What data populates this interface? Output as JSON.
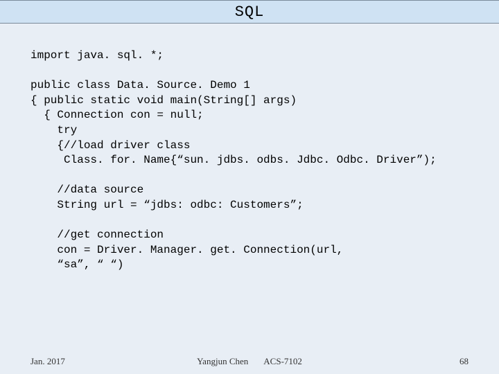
{
  "title": "SQL",
  "code": {
    "l1": "import java. sql. *;",
    "l2": "",
    "l3": "public class Data. Source. Demo 1",
    "l4": "{ public static void main(String[] args)",
    "l5": "  { Connection con = null;",
    "l6": "    try",
    "l7": "    {//load driver class",
    "l8": "     Class. for. Name{“sun. jdbs. odbs. Jdbc. Odbc. Driver”);",
    "l9": "",
    "l10": "    //data source",
    "l11": "    String url = “jdbs: odbc: Customers”;",
    "l12": "",
    "l13": "    //get connection",
    "l14": "    con = Driver. Manager. get. Connection(url,",
    "l15": "    “sa”, “ “)"
  },
  "footer": {
    "left": "Jan. 2017",
    "center": "Yangjun Chen       ACS-7102",
    "right": "68"
  }
}
